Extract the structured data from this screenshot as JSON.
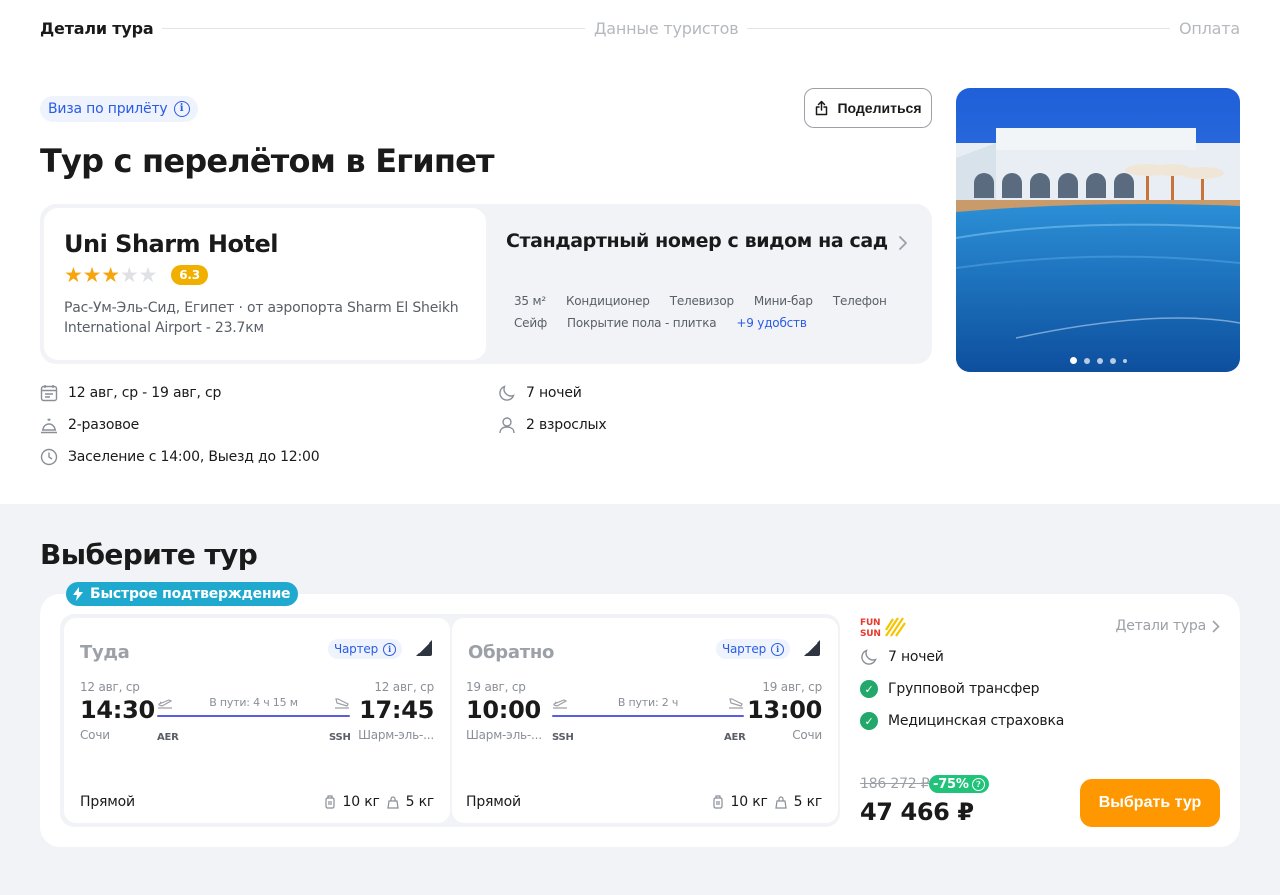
{
  "stepper": {
    "step1": "Детали тура",
    "step2": "Данные туристов",
    "step3": "Оплата"
  },
  "header": {
    "visa_badge": "Виза по прилёту",
    "share_label": "Поделиться",
    "title": "Тур с перелётом в Египет"
  },
  "hotel": {
    "name": "Uni Sharm Hotel",
    "stars": 3,
    "rating": "6.3",
    "location": "Рас-Ум-Эль-Сид, Египет · от аэропорта Sharm El Sheikh International Airport - 23.7км"
  },
  "room": {
    "title": "Стандартный номер с видом на сад",
    "amenities": [
      "35 м²",
      "Кондиционер",
      "Телевизор",
      "Мини-бар",
      "Телефон",
      "Сейф",
      "Покрытие пола - плитка"
    ],
    "more": "+9 удобств"
  },
  "details": {
    "dates": "12 авг, ср - 19 авг, ср",
    "meals": "2-разовое",
    "checkin": "Заселение с 14:00, Выезд до 12:00",
    "nights": "7 ночей",
    "guests": "2 взрослых"
  },
  "photo": {
    "slides": 5,
    "active_slide": 1
  },
  "tours": {
    "section_title": "Выберите тур",
    "fast_badge": "Быстрое подтверждение",
    "outbound": {
      "direction": "Туда",
      "charter": "Чартер",
      "dep_date": "12 авг, ср",
      "dep_time": "14:30",
      "dep_city": "Сочи",
      "dep_code": "AER",
      "duration": "В пути: 4 ч 15 м",
      "arr_date": "12 авг, ср",
      "arr_time": "17:45",
      "arr_city": "Шарм-эль-...",
      "arr_code": "SSH",
      "type": "Прямой",
      "baggage": "10 кг",
      "hand": "5 кг"
    },
    "inbound": {
      "direction": "Обратно",
      "charter": "Чартер",
      "dep_date": "19 авг, ср",
      "dep_time": "10:00",
      "dep_city": "Шарм-эль-...",
      "dep_code": "SSH",
      "duration": "В пути: 2 ч",
      "arr_date": "19 авг, ср",
      "arr_time": "13:00",
      "arr_city": "Сочи",
      "arr_code": "AER",
      "type": "Прямой",
      "baggage": "10 кг",
      "hand": "5 кг"
    },
    "operator_logo": "FUN SUN",
    "tour_details_link": "Детали тура",
    "nights": "7 ночей",
    "includes": [
      "Групповой трансфер",
      "Медицинская страховка"
    ],
    "old_price": "186 272 ₽",
    "discount": "-75%",
    "price": "47 466 ₽",
    "select_button": "Выбрать тур"
  },
  "colors": {
    "accent_blue": "#2a5ce6",
    "button_orange": "#ff9800",
    "star_yellow": "#f6a60c",
    "rating_badge": "#f1b000",
    "discount_green": "#21c27a",
    "check_green": "#21a86a",
    "fast_badge": "#1fa9cf"
  }
}
